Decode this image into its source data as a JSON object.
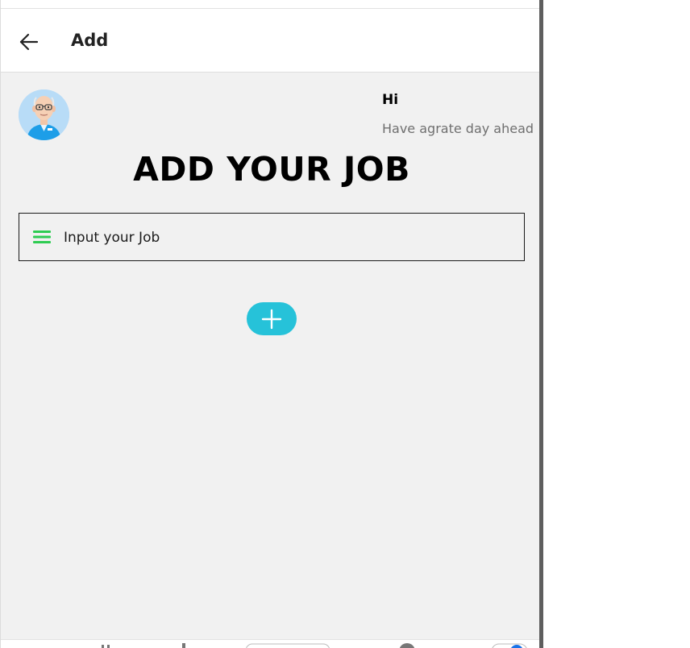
{
  "app_bar": {
    "title": "Add",
    "back_icon": "arrow-left-icon"
  },
  "greeting": {
    "title": "Hi",
    "subtitle": "Have agrate day ahead"
  },
  "page": {
    "title": "ADD YOUR JOB"
  },
  "job_input": {
    "icon": "menu-icon",
    "placeholder": "Input your Job"
  },
  "add_button": {
    "icon": "plus-icon"
  },
  "colors": {
    "background": "#f1f1f1",
    "accent": "#26c2d9",
    "menu_icon": "#2ecc52",
    "app_bar": "#ffffff"
  }
}
